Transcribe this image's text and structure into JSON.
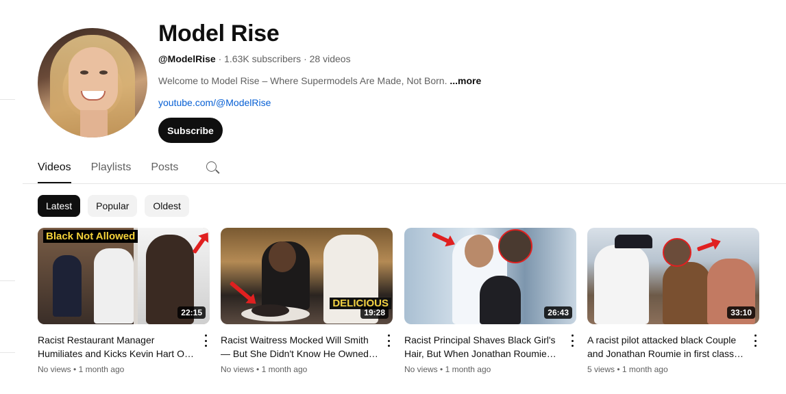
{
  "channel": {
    "name": "Model Rise",
    "handle": "@ModelRise",
    "subscribers": "1.63K subscribers",
    "video_count": "28 videos",
    "description": "Welcome to Model Rise – Where Supermodels Are Made, Not Born.",
    "more_label": "...more",
    "link": "youtube.com/@ModelRise",
    "subscribe_label": "Subscribe"
  },
  "tabs": [
    {
      "label": "Videos",
      "active": true
    },
    {
      "label": "Playlists",
      "active": false
    },
    {
      "label": "Posts",
      "active": false
    }
  ],
  "chips": [
    {
      "label": "Latest",
      "active": true
    },
    {
      "label": "Popular",
      "active": false
    },
    {
      "label": "Oldest",
      "active": false
    }
  ],
  "videos": [
    {
      "title": "Racist Restaurant Manager Humiliates and Kicks Kevin Hart O…",
      "duration": "22:15",
      "views": "No views",
      "age": "1 month ago",
      "thumb_text": "Black Not Allowed"
    },
    {
      "title": "Racist Waitress Mocked Will Smith — But She Didn't Know He Owned…",
      "duration": "19:28",
      "views": "No views",
      "age": "1 month ago",
      "thumb_text": "DELICIOUS"
    },
    {
      "title": "Racist Principal Shaves Black Girl's Hair, But When Jonathan Roumie…",
      "duration": "26:43",
      "views": "No views",
      "age": "1 month ago"
    },
    {
      "title": "A racist pilot attacked black Couple and Jonathan Roumie in first class…",
      "duration": "33:10",
      "views": "5 views",
      "age": "1 month ago"
    }
  ],
  "meta_separator": "•",
  "icons": [
    "search-icon",
    "more-vert-icon"
  ]
}
